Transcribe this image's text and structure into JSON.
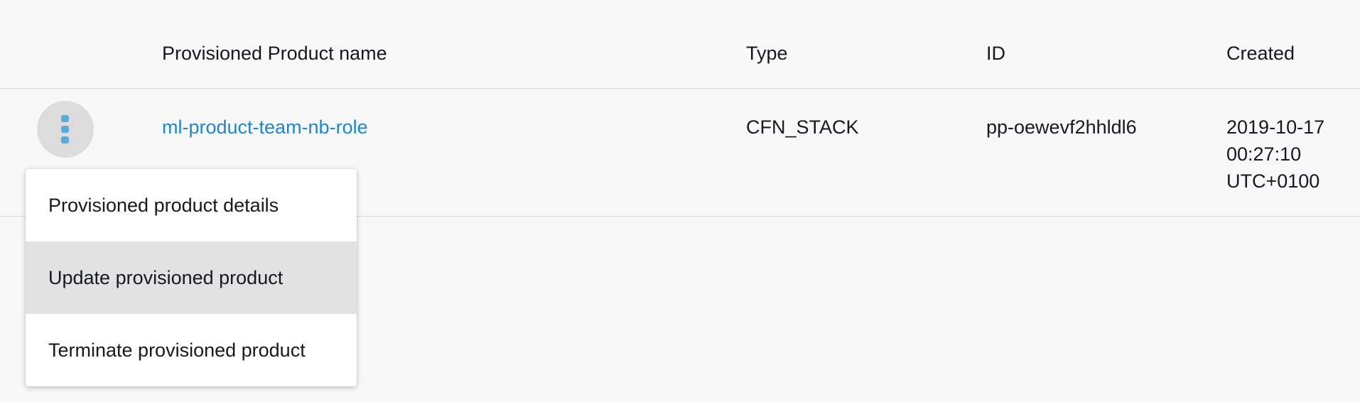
{
  "table": {
    "columns": {
      "name": "Provisioned Product name",
      "type": "Type",
      "id": "ID",
      "created": "Created"
    },
    "rows": [
      {
        "name": "ml-product-team-nb-role",
        "type": "CFN_STACK",
        "id": "pp-oewevf2hhldl6",
        "created_lines": [
          "2019-10-17",
          "00:27:10",
          "UTC+0100"
        ]
      }
    ]
  },
  "actions_menu": {
    "trigger_icon": "kebab-vertical-icon",
    "items": [
      {
        "label": "Provisioned product details",
        "highlighted": false
      },
      {
        "label": "Update provisioned product",
        "highlighted": true
      },
      {
        "label": "Terminate provisioned product",
        "highlighted": false
      }
    ]
  },
  "colors": {
    "link": "#1f87c9",
    "kebab_dots": "#5fa8d3",
    "page_background": "#f8f8f8",
    "menu_highlight": "#e2e2e2"
  }
}
